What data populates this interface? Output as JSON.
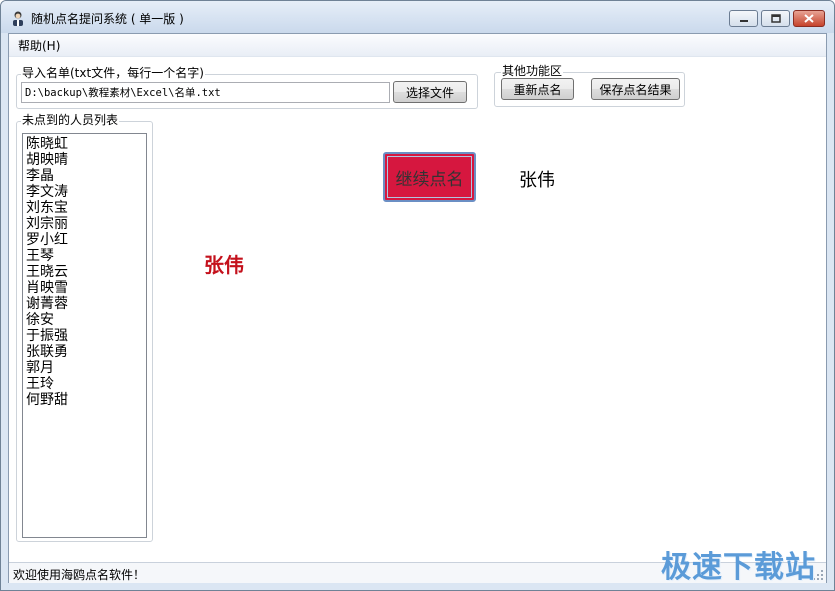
{
  "window": {
    "title": "随机点名提问系统 ( 单一版 )"
  },
  "menu": {
    "help": "帮助(H)"
  },
  "import_group": {
    "label": "导入名单(txt文件，每行一个名字)",
    "path_value": "D:\\backup\\教程素材\\Excel\\名单.txt",
    "choose_file_label": "选择文件"
  },
  "other_group": {
    "label": "其他功能区",
    "restart_label": "重新点名",
    "save_label": "保存点名结果"
  },
  "uncalled_group": {
    "label": "未点到的人员列表",
    "names": [
      "陈晓虹",
      "胡映晴",
      "李晶",
      "李文涛",
      "刘东宝",
      "刘宗丽",
      "罗小红",
      "王琴",
      "王晓云",
      "肖映雪",
      "谢菁蓉",
      "徐安",
      "于振强",
      "张联勇",
      "郭月",
      "王玲",
      "何野甜"
    ]
  },
  "main": {
    "continue_label": "继续点名",
    "continue_color": "#d6173f",
    "current_name": "张伟",
    "big_name": "张伟",
    "big_name_color": "#c4111c"
  },
  "status": {
    "text": "欢迎使用海鸥点名软件！"
  },
  "watermark": {
    "text": "极速下载站"
  }
}
